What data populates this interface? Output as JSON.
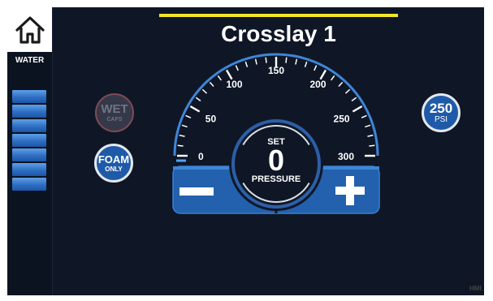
{
  "app": {
    "title": "Crosslay 1",
    "accent_color": "#f2e62a"
  },
  "sidebar": {
    "home_icon": "home-icon",
    "water_label": "WATER",
    "water_level_segments": 7
  },
  "buttons": {
    "wet": {
      "label": "WET",
      "sub": "CAFS"
    },
    "foam": {
      "label": "FOAM",
      "sub": "ONLY"
    },
    "psi": {
      "value": "250",
      "unit": "PSI"
    }
  },
  "gauge": {
    "scale_min": 0,
    "scale_max": 300,
    "tick_labels": [
      "0",
      "50",
      "100",
      "150",
      "200",
      "250",
      "300"
    ],
    "current_value": 0,
    "set_label": "SET",
    "set_value": "0",
    "pressure_label": "PRESSURE",
    "minus_icon": "minus-icon",
    "plus_icon": "plus-icon"
  },
  "footer": {
    "logo_text": "HMI"
  }
}
